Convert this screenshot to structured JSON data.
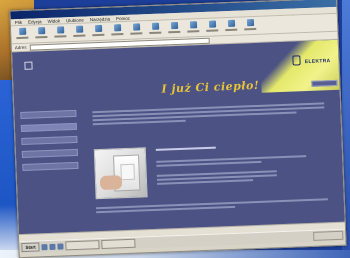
{
  "browser": {
    "window_title": "",
    "menu": [
      "Plik",
      "Edycja",
      "Widok",
      "Ulubione",
      "Narzędzia",
      "Pomoc"
    ],
    "address_label": "Adres",
    "address_value": ""
  },
  "page": {
    "headline": "I już Ci ciepło!",
    "brand": "ELEKTRA",
    "nav_items": [
      "",
      "",
      "",
      "",
      ""
    ]
  },
  "taskbar": {
    "start_label": "Start"
  },
  "colors": {
    "page_background": "#4c5283",
    "headline": "#e9c53a",
    "banner_yellow": "#f1f38a"
  }
}
